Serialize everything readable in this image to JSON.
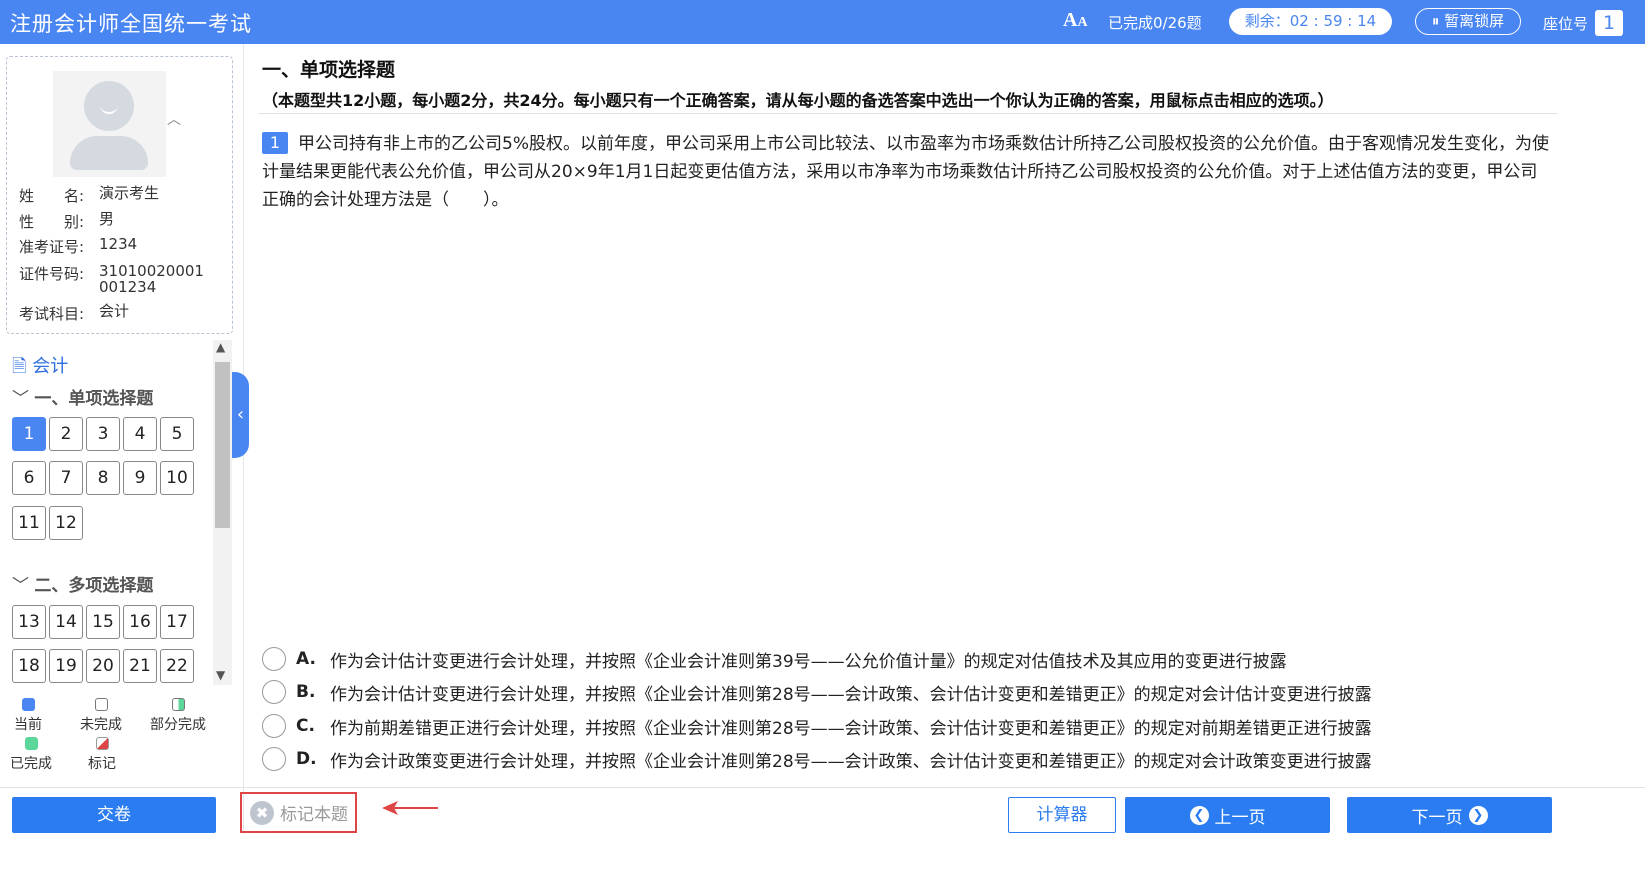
{
  "header": {
    "app_title": "注册会计师全国统一考试",
    "font_size_icon": "A",
    "progress": "已完成0/26题",
    "timer": "剩余：02 : 59 : 14",
    "pause_button": "⏸ 暂离锁屏",
    "seat_label": "座位号",
    "seat_number": "1"
  },
  "candidate": {
    "name_label": "姓　　名:",
    "name": "演示考生",
    "gender_label": "性　　别:",
    "gender": "男",
    "ticket_label": "准考证号:",
    "ticket": "1234",
    "id_label": "证件号码:",
    "id": "31010020001001234",
    "subject_label": "考试科目:",
    "subject": "会计"
  },
  "navigator": {
    "subject_title": "会计",
    "sections": [
      {
        "title": "一、单项选择题",
        "numbers": [
          "1",
          "2",
          "3",
          "4",
          "5",
          "6",
          "7",
          "8",
          "9",
          "10",
          "11",
          "12"
        ]
      },
      {
        "title": "二、多项选择题",
        "numbers": [
          "13",
          "14",
          "15",
          "16",
          "17",
          "18",
          "19",
          "20",
          "21",
          "22"
        ]
      }
    ],
    "current": "1"
  },
  "legend": {
    "current": "当前",
    "unfinished": "未完成",
    "partial": "部分完成",
    "finished": "已完成",
    "marked": "标记"
  },
  "colors": {
    "primary": "#4a86f2",
    "button_blue": "#2a7cf0",
    "legend_current": "#4a86f2",
    "legend_finished": "#5cd69a",
    "marked_red": "#e04545"
  },
  "section": {
    "heading": "一、单项选择题",
    "description": "（本题型共12小题，每小题2分，共24分。每小题只有一个正确答案，请从每小题的备选答案中选出一个你认为正确的答案，用鼠标点击相应的选项。）"
  },
  "question": {
    "number": "1",
    "stem": "甲公司持有非上市的乙公司5%股权。以前年度，甲公司采用上市公司比较法、以市盈率为市场乘数估计所持乙公司股权投资的公允价值。由于客观情况发生变化，为使计量结果更能代表公允价值，甲公司从20×9年1月1日起变更估值方法，采用以市净率为市场乘数估计所持乙公司股权投资的公允价值。对于上述估值方法的变更，甲公司正确的会计处理方法是（　　）。",
    "options": [
      {
        "letter": "A.",
        "text": "作为会计估计变更进行会计处理，并按照《企业会计准则第39号——公允价值计量》的规定对估值技术及其应用的变更进行披露"
      },
      {
        "letter": "B.",
        "text": "作为会计估计变更进行会计处理，并按照《企业会计准则第28号——会计政策、会计估计变更和差错更正》的规定对会计估计变更进行披露"
      },
      {
        "letter": "C.",
        "text": "作为前期差错更正进行会计处理，并按照《企业会计准则第28号——会计政策、会计估计变更和差错更正》的规定对前期差错更正进行披露"
      },
      {
        "letter": "D.",
        "text": "作为会计政策变更进行会计处理，并按照《企业会计准则第28号——会计政策、会计估计变更和差错更正》的规定对会计政策变更进行披露"
      }
    ]
  },
  "footer": {
    "submit": "交卷",
    "mark": "标记本题",
    "calculator": "计算器",
    "prev": "上一页",
    "next": "下一页"
  }
}
